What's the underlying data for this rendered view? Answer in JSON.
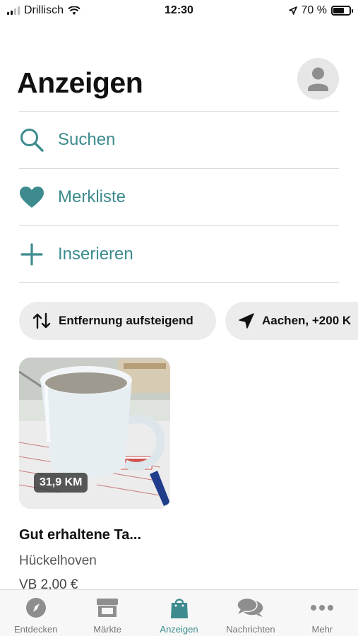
{
  "status_bar": {
    "carrier": "Drillisch",
    "time": "12:30",
    "battery_percent": "70 %",
    "battery_level": 0.7
  },
  "header": {
    "title": "Anzeigen",
    "avatar_icon": "user-avatar-icon"
  },
  "menu": {
    "items": [
      {
        "label": "Suchen",
        "icon": "search-icon"
      },
      {
        "label": "Merkliste",
        "icon": "heart-icon"
      },
      {
        "label": "Inserieren",
        "icon": "plus-icon"
      }
    ]
  },
  "filters": {
    "sort_label": "Entfernung aufsteigend",
    "sort_icon": "sort-arrows-icon",
    "location_label": "Aachen, +200 K",
    "location_icon": "location-arrow-icon"
  },
  "listing": {
    "distance": "31,9 KM",
    "title": "Gut erhaltene Ta...",
    "location": "Hückelhoven",
    "price": "VB 2,00 €"
  },
  "tab_bar": {
    "active": "Anzeigen",
    "tabs": [
      {
        "label": "Entdecken",
        "icon": "compass-icon"
      },
      {
        "label": "Märkte",
        "icon": "store-icon"
      },
      {
        "label": "Anzeigen",
        "icon": "shopping-bag-icon"
      },
      {
        "label": "Nachrichten",
        "icon": "chat-bubbles-icon"
      },
      {
        "label": "Mehr",
        "icon": "more-dots-icon"
      }
    ]
  },
  "colors": {
    "accent": "#3d8b8e",
    "chip_background": "#ececec",
    "divider": "#dcdcdc",
    "tab_inactive": "#777777"
  }
}
